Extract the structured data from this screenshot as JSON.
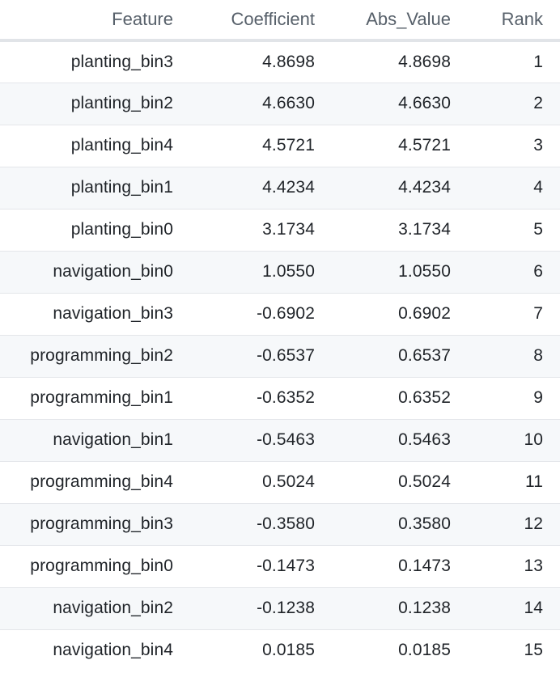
{
  "table": {
    "columns": [
      "Feature",
      "Coefficient",
      "Abs_Value",
      "Rank"
    ],
    "rows": [
      [
        "planting_bin3",
        "4.8698",
        "4.8698",
        "1"
      ],
      [
        "planting_bin2",
        "4.6630",
        "4.6630",
        "2"
      ],
      [
        "planting_bin4",
        "4.5721",
        "4.5721",
        "3"
      ],
      [
        "planting_bin1",
        "4.4234",
        "4.4234",
        "4"
      ],
      [
        "planting_bin0",
        "3.1734",
        "3.1734",
        "5"
      ],
      [
        "navigation_bin0",
        "1.0550",
        "1.0550",
        "6"
      ],
      [
        "navigation_bin3",
        "-0.6902",
        "0.6902",
        "7"
      ],
      [
        "programming_bin2",
        "-0.6537",
        "0.6537",
        "8"
      ],
      [
        "programming_bin1",
        "-0.6352",
        "0.6352",
        "9"
      ],
      [
        "navigation_bin1",
        "-0.5463",
        "0.5463",
        "10"
      ],
      [
        "programming_bin4",
        "0.5024",
        "0.5024",
        "11"
      ],
      [
        "programming_bin3",
        "-0.3580",
        "0.3580",
        "12"
      ],
      [
        "programming_bin0",
        "-0.1473",
        "0.1473",
        "13"
      ],
      [
        "navigation_bin2",
        "-0.1238",
        "0.1238",
        "14"
      ],
      [
        "navigation_bin4",
        "0.0185",
        "0.0185",
        "15"
      ]
    ]
  },
  "colors": {
    "header_text": "#57606a",
    "cell_text": "#1f2328",
    "stripe": "#f6f8fa",
    "header_rule": "#e1e4e8",
    "row_rule": "#e4e6ea"
  }
}
